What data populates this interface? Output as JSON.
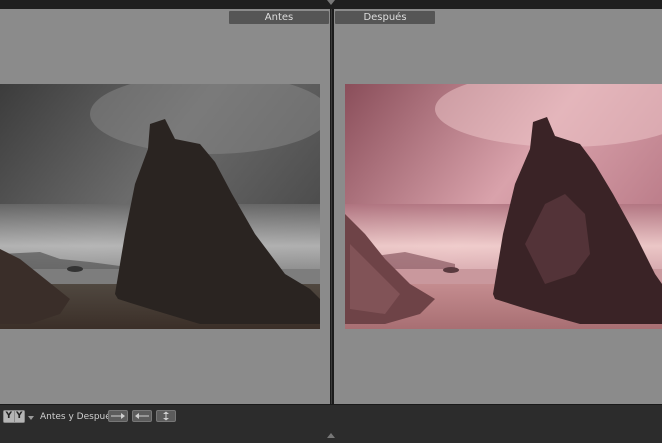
{
  "compare": {
    "before_label": "Antes",
    "after_label": "Después"
  },
  "toolbar": {
    "view_mode_glyphs": [
      "Y",
      "Y"
    ],
    "before_after_label": "Antes y Después:",
    "buttons": [
      {
        "name": "copy-before-to-after",
        "icon": "arrow-right-icon"
      },
      {
        "name": "copy-after-to-before",
        "icon": "arrow-left-icon"
      },
      {
        "name": "swap-before-after",
        "icon": "swap-icon"
      }
    ]
  },
  "colors": {
    "background": "#8b8b8b",
    "divider": "#1b1b1b",
    "label_bg": "#555555",
    "toolbar_bg": "#2c2c2c",
    "after_tint": "#c28f9a"
  }
}
